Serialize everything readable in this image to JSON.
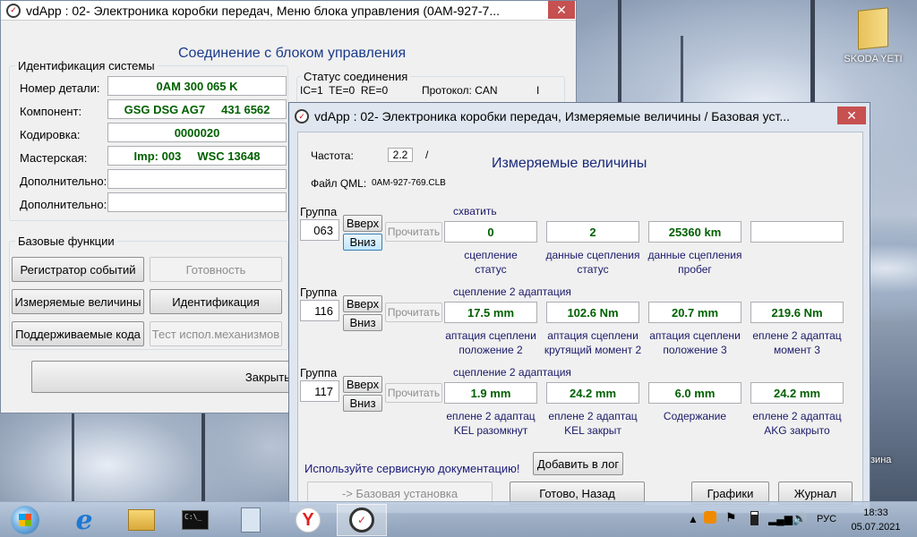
{
  "desktop": {
    "shortcut_label": "SKODA YETI",
    "partial_label": "зина"
  },
  "main_window": {
    "title": "vdApp : 02- Электроника коробки передач,  Меню блока управления (0AM-927-7...",
    "heading": "Соединение с блоком управления",
    "ident_group": "Идентификация системы",
    "rows": [
      {
        "label": "Номер детали:",
        "value": "0AM 300 065 K"
      },
      {
        "label": "Компонент:",
        "value": "GSG DSG AG7     431 6562"
      },
      {
        "label": "Кодировка:",
        "value": "0000020"
      },
      {
        "label": "Мастерская:",
        "value": "Imp: 003     WSC 13648"
      },
      {
        "label": "Дополнительно:",
        "value": ""
      },
      {
        "label": "Дополнительно:",
        "value": ""
      }
    ],
    "status_group": "Статус соединения",
    "status_text": "IC=1  TE=0  RE=0",
    "protocol": "Протокол: CAN",
    "status_sep": "I",
    "basic_group": "Базовые функции",
    "buttons": {
      "event_log": "Регистратор событий",
      "readiness": "Готовность",
      "measured": "Измеряемые величины",
      "identification": "Идентификация",
      "supported_codes": "Поддерживаемые кода",
      "actuator_test": "Тест испол.механизмов",
      "close": "Закрыть"
    }
  },
  "meas_window": {
    "title": "vdApp : 02- Электроника коробки передач,  Измеряемые величины / Базовая уст...",
    "freq_label": "Частота:",
    "freq_value": "2.2",
    "freq_sep": "/",
    "heading": "Измеряемые величины",
    "qml_label": "Файл QML:",
    "qml_value": "0AM-927-769.CLB",
    "group_label": "Группа",
    "up": "Вверх",
    "down": "Вниз",
    "read": "Прочитать",
    "groups": [
      {
        "number": "063",
        "caption": "схватить",
        "values": [
          "0",
          "2",
          "25360 km",
          ""
        ],
        "descs": [
          [
            "сцепление",
            "статус"
          ],
          [
            "данные сцепления",
            "статус"
          ],
          [
            "данные сцепления",
            "пробег"
          ],
          [
            "",
            ""
          ]
        ]
      },
      {
        "number": "116",
        "caption": "сцепление 2 адаптация",
        "values": [
          "17.5 mm",
          "102.6 Nm",
          "20.7 mm",
          "219.6 Nm"
        ],
        "descs": [
          [
            "аптация сцеплени",
            "положение 2"
          ],
          [
            "аптация сцеплени",
            "крутящий момент 2"
          ],
          [
            "аптация сцеплени",
            "положение 3"
          ],
          [
            "еплене 2 адаптац",
            "момент 3"
          ]
        ]
      },
      {
        "number": "117",
        "caption": "сцепление 2 адаптация",
        "values": [
          "1.9 mm",
          "24.2 mm",
          "6.0 mm",
          "24.2 mm"
        ],
        "descs": [
          [
            "еплене 2 адаптац",
            "KEL разомкнут"
          ],
          [
            "еплене 2 адаптац",
            "KEL закрыт"
          ],
          [
            "Содержание",
            ""
          ],
          [
            "еплене 2 адаптац",
            "AKG закрыто"
          ]
        ]
      }
    ],
    "service_note": "Используйте сервисную документацию!",
    "add_log": "Добавить в лог",
    "basic_setting": "-> Базовая установка",
    "done_back": "Готово, Назад",
    "graphs": "Графики",
    "journal": "Журнал"
  },
  "tray": {
    "lang": "РУС",
    "time": "18:33",
    "date": "05.07.2021"
  }
}
